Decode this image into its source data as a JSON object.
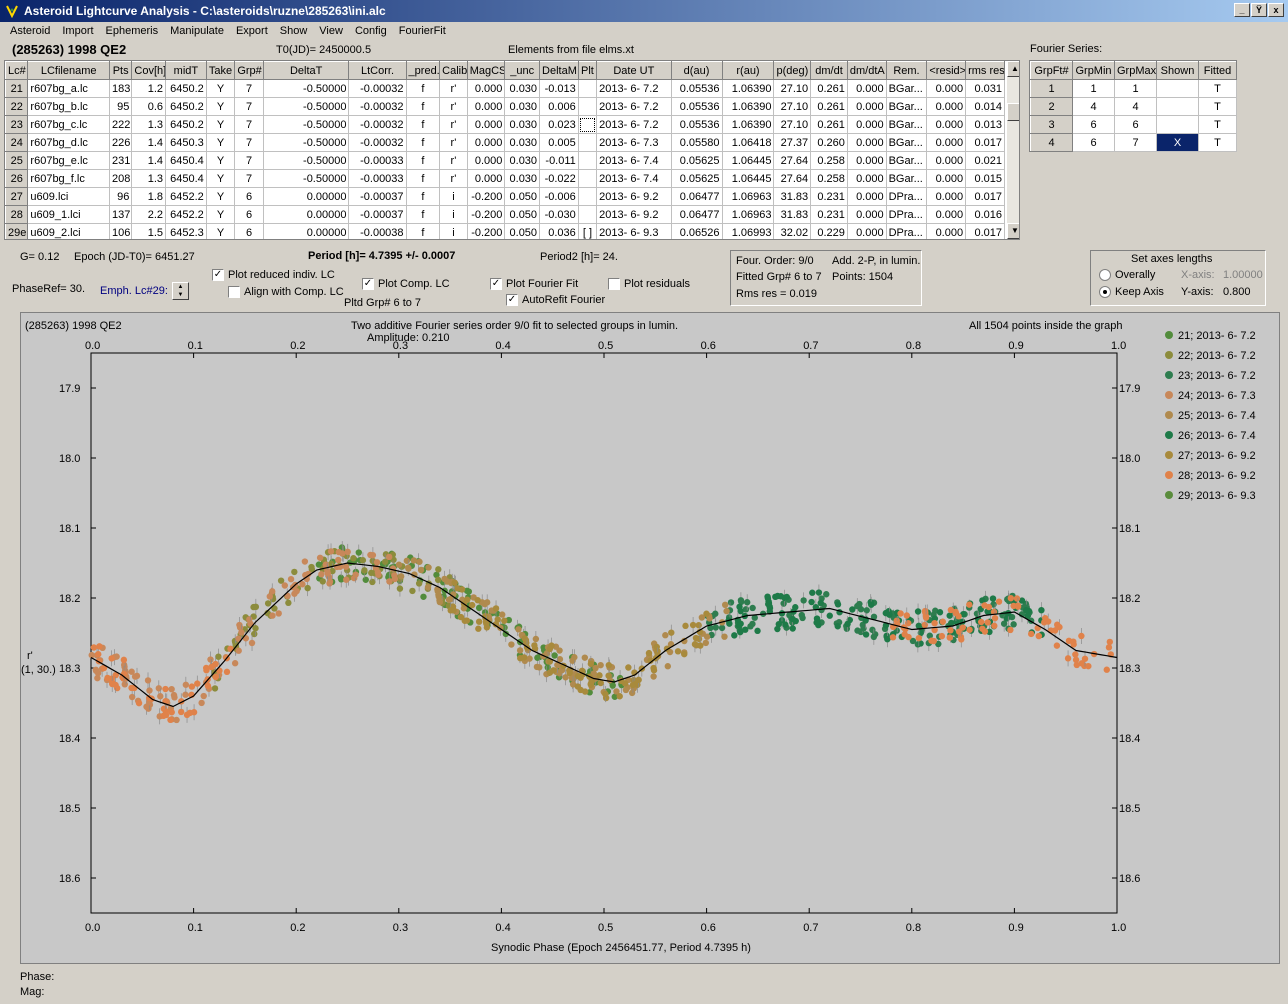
{
  "window": {
    "title": "Asteroid Lightcurve Analysis - C:\\asteroids\\ruzne\\285263\\ini.alc",
    "buttons": [
      "_",
      "Ÿ",
      "x"
    ]
  },
  "menu": [
    "Asteroid",
    "Import",
    "Ephemeris",
    "Manipulate",
    "Export",
    "Show",
    "View",
    "Config",
    "FourierFit"
  ],
  "header": {
    "asteroid": "(285263) 1998 QE2",
    "t0": "T0(JD)= 2450000.5",
    "elements": "Elements from file elms.xt"
  },
  "table": {
    "columns": [
      "Lc#",
      "LCfilename",
      "Pts",
      "Cov[h]",
      "midT",
      "Take",
      "Grp#",
      "DeltaT",
      "LtCorr.",
      "_pred.",
      "Calib.",
      "MagCS",
      "_unc",
      "DeltaM",
      "Plt",
      "Date UT",
      "d(au)",
      "r(au)",
      "p(deg)",
      "dm/dt",
      "dm/dtA",
      "Rem.",
      "<resid>",
      "rms res"
    ],
    "rows": [
      [
        "21",
        "r607bg_a.lc",
        "183",
        "1.2",
        "6450.2",
        "Y",
        "7",
        "-0.50000",
        "-0.00032",
        "f",
        "r'",
        "0.000",
        "0.030",
        "-0.013",
        "",
        "2013- 6- 7.2",
        "0.05536",
        "1.06390",
        "27.10",
        "0.261",
        "0.000",
        "BGar...",
        "0.000",
        "0.031"
      ],
      [
        "22",
        "r607bg_b.lc",
        "95",
        "0.6",
        "6450.2",
        "Y",
        "7",
        "-0.50000",
        "-0.00032",
        "f",
        "r'",
        "0.000",
        "0.030",
        "0.006",
        "",
        "2013- 6- 7.2",
        "0.05536",
        "1.06390",
        "27.10",
        "0.261",
        "0.000",
        "BGar...",
        "0.000",
        "0.014"
      ],
      [
        "23",
        "r607bg_c.lc",
        "222",
        "1.3",
        "6450.2",
        "Y",
        "7",
        "-0.50000",
        "-0.00032",
        "f",
        "r'",
        "0.000",
        "0.030",
        "0.023",
        "",
        "2013- 6- 7.2",
        "0.05536",
        "1.06390",
        "27.10",
        "0.261",
        "0.000",
        "BGar...",
        "0.000",
        "0.013"
      ],
      [
        "24",
        "r607bg_d.lc",
        "226",
        "1.4",
        "6450.3",
        "Y",
        "7",
        "-0.50000",
        "-0.00032",
        "f",
        "r'",
        "0.000",
        "0.030",
        "0.005",
        "",
        "2013- 6- 7.3",
        "0.05580",
        "1.06418",
        "27.37",
        "0.260",
        "0.000",
        "BGar...",
        "0.000",
        "0.017"
      ],
      [
        "25",
        "r607bg_e.lc",
        "231",
        "1.4",
        "6450.4",
        "Y",
        "7",
        "-0.50000",
        "-0.00033",
        "f",
        "r'",
        "0.000",
        "0.030",
        "-0.011",
        "",
        "2013- 6- 7.4",
        "0.05625",
        "1.06445",
        "27.64",
        "0.258",
        "0.000",
        "BGar...",
        "0.000",
        "0.021"
      ],
      [
        "26",
        "r607bg_f.lc",
        "208",
        "1.3",
        "6450.4",
        "Y",
        "7",
        "-0.50000",
        "-0.00033",
        "f",
        "r'",
        "0.000",
        "0.030",
        "-0.022",
        "",
        "2013- 6- 7.4",
        "0.05625",
        "1.06445",
        "27.64",
        "0.258",
        "0.000",
        "BGar...",
        "0.000",
        "0.015"
      ],
      [
        "27",
        "u609.lci",
        "96",
        "1.8",
        "6452.2",
        "Y",
        "6",
        "0.00000",
        "-0.00037",
        "f",
        "i",
        "-0.200",
        "0.050",
        "-0.006",
        "",
        "2013- 6- 9.2",
        "0.06477",
        "1.06963",
        "31.83",
        "0.231",
        "0.000",
        "DPra...",
        "0.000",
        "0.017"
      ],
      [
        "28",
        "u609_1.lci",
        "137",
        "2.2",
        "6452.2",
        "Y",
        "6",
        "0.00000",
        "-0.00037",
        "f",
        "i",
        "-0.200",
        "0.050",
        "-0.030",
        "",
        "2013- 6- 9.2",
        "0.06477",
        "1.06963",
        "31.83",
        "0.231",
        "0.000",
        "DPra...",
        "0.000",
        "0.016"
      ],
      [
        "29e",
        "u609_2.lci",
        "106",
        "1.5",
        "6452.3",
        "Y",
        "6",
        "0.00000",
        "-0.00038",
        "f",
        "i",
        "-0.200",
        "0.050",
        "0.036",
        "[ ]",
        "2013- 6- 9.3",
        "0.06526",
        "1.06993",
        "32.02",
        "0.229",
        "0.000",
        "DPra...",
        "0.000",
        "0.017"
      ]
    ]
  },
  "fourier": {
    "label": "Fourier Series:",
    "columns": [
      "GrpFt#",
      "GrpMin",
      "GrpMax",
      "Shown",
      "Fitted"
    ],
    "rows": [
      [
        "1",
        "1",
        "1",
        "",
        "T"
      ],
      [
        "2",
        "4",
        "4",
        "",
        "T"
      ],
      [
        "3",
        "6",
        "6",
        "",
        "T"
      ],
      [
        "4",
        "6",
        "7",
        "X",
        "T"
      ]
    ]
  },
  "info": {
    "g": "G= 0.12",
    "epoch": "Epoch (JD-T0)= 6451.27",
    "period": "Period [h]= 4.7395 +/- 0.0007",
    "period2": "Period2 [h]= 24.",
    "phaseref": "PhaseRef= 30.",
    "emph": "Emph. Lc#29:",
    "cb_reduced": "Plot reduced indiv. LC",
    "cb_align": "Align with Comp. LC",
    "cb_comp": "Plot Comp. LC",
    "pltd": "Pltd Grp#  6  to  7",
    "cb_fourier": "Plot Fourier Fit",
    "cb_autorefit": "AutoRefit Fourier",
    "cb_resid": "Plot residuals"
  },
  "fitinfo": {
    "order": "Four. Order:  9/0",
    "add": "Add. 2-P, in lumin.",
    "fitted": "Fitted Grp# 6 to 7",
    "points": "Points: 1504",
    "rms": "Rms res     = 0.019"
  },
  "axes": {
    "title": "Set axes lengths",
    "overall": "Overally",
    "keep": "Keep Axis",
    "xlabel": "X-axis:",
    "xval": "1.00000",
    "ylabel": "Y-axis:",
    "yval": "0.800"
  },
  "status": {
    "phase": "Phase:",
    "mag": "Mag:"
  },
  "chart_data": {
    "type": "scatter",
    "title": "Two additive Fourier series order 9/0 fit to selected groups in lumin.",
    "subtitle": "Amplitude: 0.210",
    "corner_left": "(285263) 1998 QE2",
    "corner_right": "All 1504 points inside the graph",
    "xlabel": "Synodic Phase (Epoch 2456451.77, Period 4.7395 h)",
    "ylabel": "r'",
    "ylabel2": "(1, 30.)",
    "xlim": [
      0,
      1
    ],
    "ylim": [
      18.65,
      17.85
    ],
    "xticks": [
      "0.0",
      "0.1",
      "0.2",
      "0.3",
      "0.4",
      "0.5",
      "0.6",
      "0.7",
      "0.8",
      "0.9",
      "1.0"
    ],
    "yticks": [
      "17.9",
      "18.0",
      "18.1",
      "18.2",
      "18.3",
      "18.4",
      "18.5",
      "18.6"
    ],
    "fit_curve": {
      "x": [
        0,
        0.03,
        0.06,
        0.08,
        0.1,
        0.13,
        0.16,
        0.2,
        0.22,
        0.25,
        0.28,
        0.31,
        0.34,
        0.37,
        0.4,
        0.43,
        0.46,
        0.49,
        0.51,
        0.53,
        0.56,
        0.6,
        0.64,
        0.68,
        0.72,
        0.76,
        0.8,
        0.84,
        0.87,
        0.9,
        0.93,
        0.96,
        1.0
      ],
      "y": [
        18.285,
        18.31,
        18.345,
        18.355,
        18.34,
        18.29,
        18.235,
        18.18,
        18.16,
        18.15,
        18.155,
        18.165,
        18.185,
        18.215,
        18.245,
        18.275,
        18.295,
        18.315,
        18.32,
        18.31,
        18.275,
        18.24,
        18.225,
        18.22,
        18.215,
        18.23,
        18.245,
        18.24,
        18.225,
        18.22,
        18.245,
        18.275,
        18.285
      ]
    },
    "series": [
      {
        "name": "21; 2013- 6- 7.2",
        "color": "#528c3c"
      },
      {
        "name": "22; 2013- 6- 7.2",
        "color": "#8c8c3c"
      },
      {
        "name": "23; 2013- 6- 7.2",
        "color": "#2e7d4f"
      },
      {
        "name": "24; 2013- 6- 7.3",
        "color": "#c8885a"
      },
      {
        "name": "25; 2013- 6- 7.4",
        "color": "#b08a4e"
      },
      {
        "name": "26; 2013- 6- 7.4",
        "color": "#1e7a48"
      },
      {
        "name": "27; 2013- 6- 9.2",
        "color": "#a88a3c"
      },
      {
        "name": "28; 2013- 6- 9.2",
        "color": "#e0824a"
      },
      {
        "name": "29; 2013- 6- 9.3",
        "color": "#5a8c3c"
      }
    ]
  }
}
